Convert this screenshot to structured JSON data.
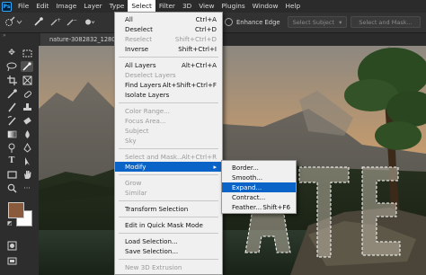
{
  "app": {
    "logo": "Ps"
  },
  "menubar": [
    "File",
    "Edit",
    "Image",
    "Layer",
    "Type",
    "Select",
    "Filter",
    "3D",
    "View",
    "Plugins",
    "Window",
    "Help"
  ],
  "options": {
    "enhance_edge": "Enhance Edge",
    "select_subject": "Select Subject",
    "select_mask": "Select and Mask..."
  },
  "document": {
    "tab": "nature-3082832_1280.jpg"
  },
  "select_menu": {
    "items": [
      {
        "label": "All",
        "shortcut": "Ctrl+A"
      },
      {
        "label": "Deselect",
        "shortcut": "Ctrl+D"
      },
      {
        "label": "Reselect",
        "shortcut": "Shift+Ctrl+D"
      },
      {
        "label": "Inverse",
        "shortcut": "Shift+Ctrl+I"
      },
      {
        "label": "All Layers",
        "shortcut": "Alt+Ctrl+A"
      },
      {
        "label": "Deselect Layers",
        "shortcut": ""
      },
      {
        "label": "Find Layers",
        "shortcut": "Alt+Shift+Ctrl+F"
      },
      {
        "label": "Isolate Layers",
        "shortcut": ""
      },
      {
        "label": "Color Range...",
        "shortcut": ""
      },
      {
        "label": "Focus Area...",
        "shortcut": ""
      },
      {
        "label": "Subject",
        "shortcut": ""
      },
      {
        "label": "Sky",
        "shortcut": ""
      },
      {
        "label": "Select and Mask...",
        "shortcut": "Alt+Ctrl+R"
      },
      {
        "label": "Modify",
        "shortcut": "▸"
      },
      {
        "label": "Grow",
        "shortcut": ""
      },
      {
        "label": "Similar",
        "shortcut": ""
      },
      {
        "label": "Transform Selection",
        "shortcut": ""
      },
      {
        "label": "Edit in Quick Mask Mode",
        "shortcut": ""
      },
      {
        "label": "Load Selection...",
        "shortcut": ""
      },
      {
        "label": "Save Selection...",
        "shortcut": ""
      },
      {
        "label": "New 3D Extrusion",
        "shortcut": ""
      }
    ]
  },
  "modify_menu": {
    "items": [
      {
        "label": "Border...",
        "shortcut": ""
      },
      {
        "label": "Smooth...",
        "shortcut": ""
      },
      {
        "label": "Expand...",
        "shortcut": ""
      },
      {
        "label": "Contract...",
        "shortcut": ""
      },
      {
        "label": "Feather...",
        "shortcut": "Shift+F6"
      }
    ]
  },
  "colors": {
    "foreground": "#8a5a3c",
    "background": "#ffffff",
    "highlight": "#0a64c8"
  }
}
